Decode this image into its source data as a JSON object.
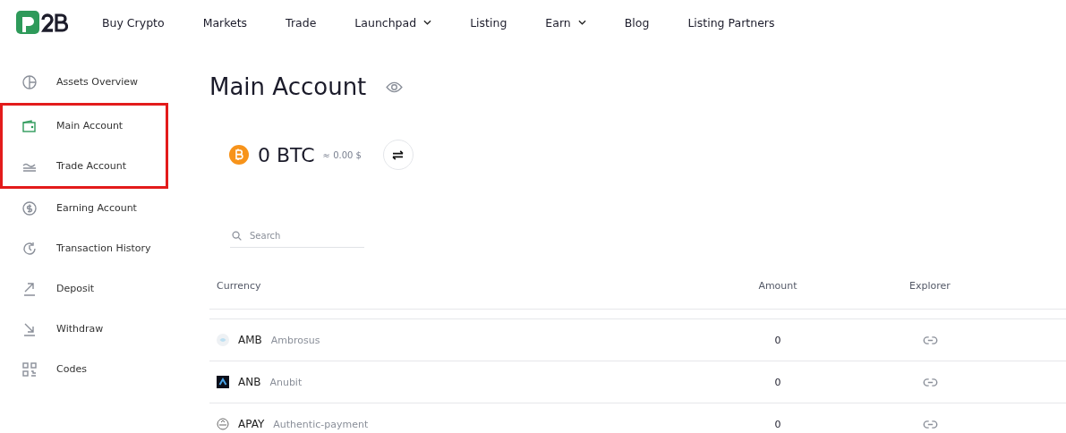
{
  "nav": {
    "items": [
      {
        "label": "Buy Crypto",
        "dropdown": false
      },
      {
        "label": "Markets",
        "dropdown": false
      },
      {
        "label": "Trade",
        "dropdown": false
      },
      {
        "label": "Launchpad",
        "dropdown": true
      },
      {
        "label": "Listing",
        "dropdown": false
      },
      {
        "label": "Earn",
        "dropdown": true
      },
      {
        "label": "Blog",
        "dropdown": false
      },
      {
        "label": "Listing Partners",
        "dropdown": false
      }
    ]
  },
  "sidebar": {
    "groups": [
      {
        "highlighted": false,
        "items": [
          {
            "label": "Assets Overview",
            "selected": false
          }
        ]
      },
      {
        "highlighted": true,
        "items": [
          {
            "label": "Main Account",
            "selected": true
          },
          {
            "label": "Trade Account",
            "selected": false
          }
        ]
      },
      {
        "highlighted": false,
        "items": [
          {
            "label": "Earning Account",
            "selected": false
          },
          {
            "label": "Transaction History",
            "selected": false
          },
          {
            "label": "Deposit",
            "selected": false
          },
          {
            "label": "Withdraw",
            "selected": false
          },
          {
            "label": "Codes",
            "selected": false
          }
        ]
      }
    ]
  },
  "page": {
    "title": "Main Account",
    "balance": "0 BTC",
    "approx": "≈ 0.00 $"
  },
  "search": {
    "placeholder": "Search"
  },
  "table": {
    "columns": [
      "Currency",
      "Amount",
      "Explorer"
    ],
    "rows": [
      {
        "ticker": "AMB",
        "name": "Ambrosus",
        "amount": "0"
      },
      {
        "ticker": "ANB",
        "name": "Anubit",
        "amount": "0"
      },
      {
        "ticker": "APAY",
        "name": "Authentic-payment",
        "amount": "0"
      }
    ]
  }
}
